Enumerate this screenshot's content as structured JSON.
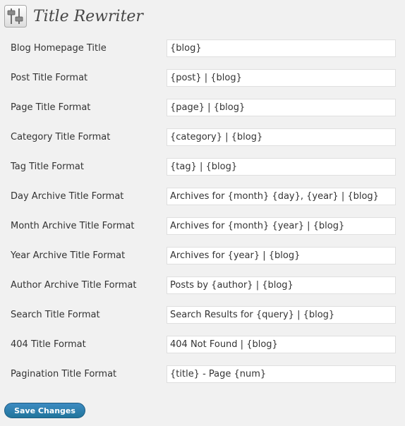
{
  "header": {
    "title": "Title Rewriter",
    "icon": "settings-sliders-icon"
  },
  "fields": [
    {
      "label": "Blog Homepage Title",
      "value": "{blog}"
    },
    {
      "label": "Post Title Format",
      "value": "{post} | {blog}"
    },
    {
      "label": "Page Title Format",
      "value": "{page} | {blog}"
    },
    {
      "label": "Category Title Format",
      "value": "{category} | {blog}"
    },
    {
      "label": "Tag Title Format",
      "value": "{tag} | {blog}"
    },
    {
      "label": "Day Archive Title Format",
      "value": "Archives for {month} {day}, {year} | {blog}"
    },
    {
      "label": "Month Archive Title Format",
      "value": "Archives for {month} {year} | {blog}"
    },
    {
      "label": "Year Archive Title Format",
      "value": "Archives for {year} | {blog}"
    },
    {
      "label": "Author Archive Title Format",
      "value": "Posts by {author} | {blog}"
    },
    {
      "label": "Search Title Format",
      "value": "Search Results for {query} | {blog}"
    },
    {
      "label": "404 Title Format",
      "value": "404 Not Found | {blog}"
    },
    {
      "label": "Pagination Title Format",
      "value": "{title} - Page {num}"
    }
  ],
  "actions": {
    "save_label": "Save Changes"
  },
  "colors": {
    "background": "#f1f1f1",
    "button": "#21759b",
    "input_border": "#dfdfdf"
  }
}
